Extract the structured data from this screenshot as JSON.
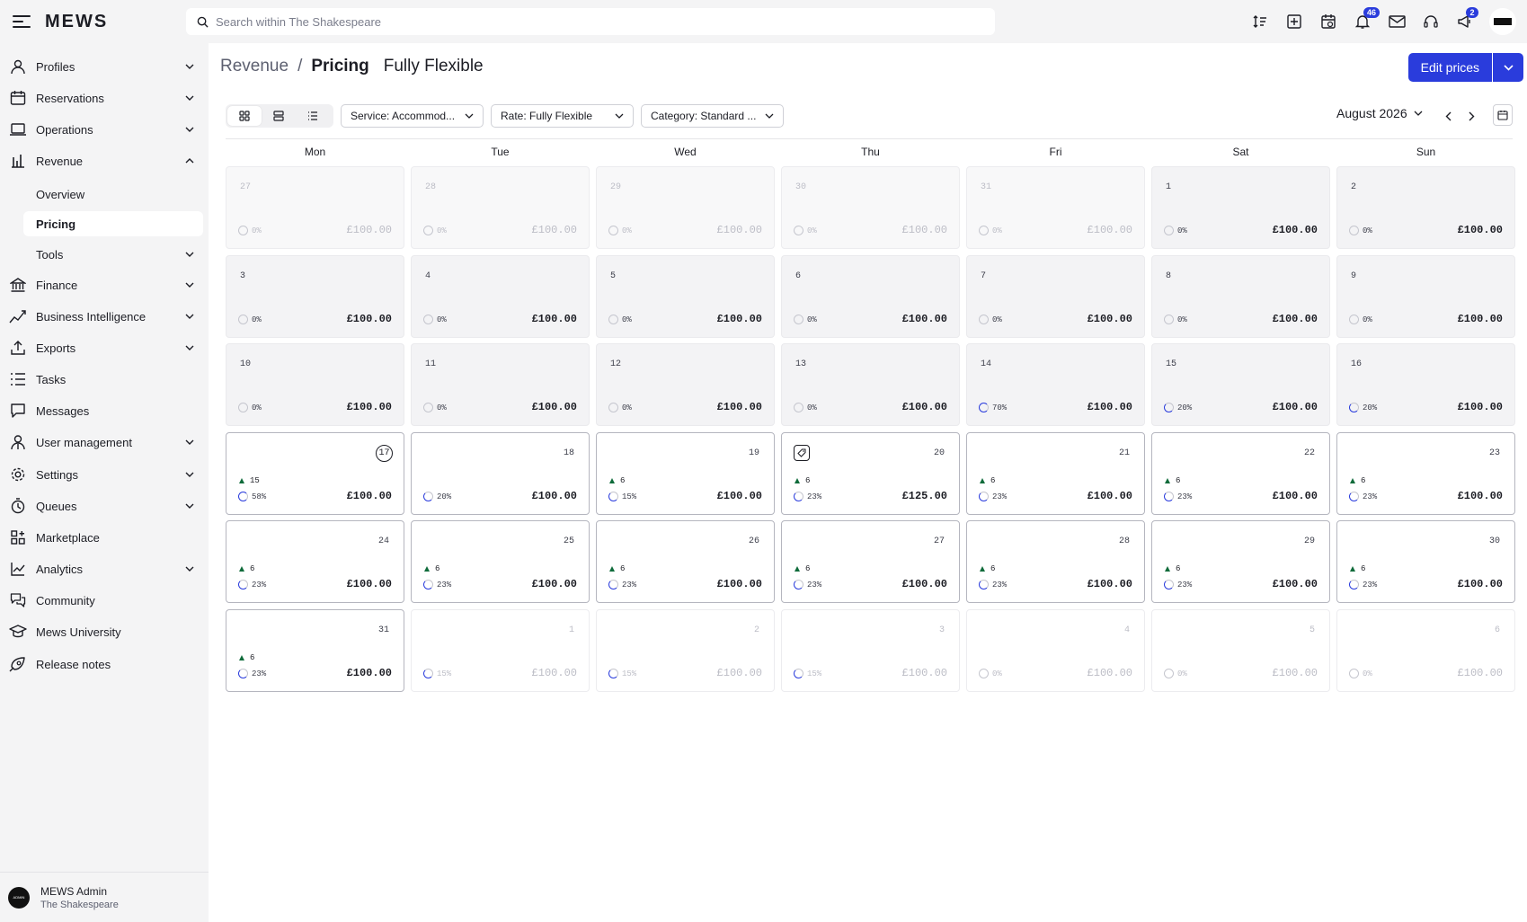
{
  "app": {
    "logo": "MEWS"
  },
  "search": {
    "placeholder": "Search within The Shakespeare"
  },
  "topbar": {
    "icons": [
      "sort-icon",
      "add-icon",
      "calendar-check-icon",
      "bell-icon",
      "mail-icon",
      "headset-icon",
      "megaphone-icon",
      "avatar"
    ],
    "notifications_badge": "46",
    "announcements_badge": "2"
  },
  "sidebar": {
    "items": [
      {
        "label": "Profiles",
        "icon": "person-icon",
        "expandable": true
      },
      {
        "label": "Reservations",
        "icon": "calendar-icon",
        "expandable": true
      },
      {
        "label": "Operations",
        "icon": "laptop-icon",
        "expandable": true
      },
      {
        "label": "Revenue",
        "icon": "bar-chart-icon",
        "expandable": true,
        "expanded": true
      },
      {
        "label": "Tools",
        "icon": "",
        "expandable": true
      },
      {
        "label": "Finance",
        "icon": "bank-icon",
        "expandable": true
      },
      {
        "label": "Business Intelligence",
        "icon": "trend-icon",
        "expandable": true
      },
      {
        "label": "Exports",
        "icon": "export-icon",
        "expandable": true
      },
      {
        "label": "Tasks",
        "icon": "tasks-icon",
        "expandable": false
      },
      {
        "label": "Messages",
        "icon": "message-icon",
        "expandable": false
      },
      {
        "label": "User management",
        "icon": "user-manage-icon",
        "expandable": true
      },
      {
        "label": "Settings",
        "icon": "gear-icon",
        "expandable": true
      },
      {
        "label": "Queues",
        "icon": "clock-icon",
        "expandable": true
      },
      {
        "label": "Marketplace",
        "icon": "apps-icon",
        "expandable": false
      },
      {
        "label": "Analytics",
        "icon": "line-chart-icon",
        "expandable": true
      },
      {
        "label": "Community",
        "icon": "community-icon",
        "expandable": false
      },
      {
        "label": "Mews University",
        "icon": "graduation-icon",
        "expandable": false
      },
      {
        "label": "Release notes",
        "icon": "rocket-icon",
        "expandable": false
      }
    ],
    "sub_items": [
      {
        "label": "Overview",
        "active": false
      },
      {
        "label": "Pricing",
        "active": true
      }
    ]
  },
  "user": {
    "name": "MEWS Admin",
    "property": "The Shakespeare",
    "avatar_text": "ADMIN"
  },
  "breadcrumb": {
    "section": "Revenue",
    "separator": "/",
    "page": "Pricing",
    "rate": "Fully Flexible"
  },
  "actions": {
    "edit_prices": "Edit prices"
  },
  "filters": {
    "service": "Service: Accommod...",
    "rate": "Rate: Fully Flexible",
    "category": "Category: Standard ..."
  },
  "calendar": {
    "month": "August 2026",
    "weekdays": [
      "Mon",
      "Tue",
      "Wed",
      "Thu",
      "Fri",
      "Sat",
      "Sun"
    ],
    "weeks": [
      [
        {
          "day": "27",
          "occ": "0%",
          "price": "£100.00",
          "state": "past",
          "outside": true
        },
        {
          "day": "28",
          "occ": "0%",
          "price": "£100.00",
          "state": "past",
          "outside": true
        },
        {
          "day": "29",
          "occ": "0%",
          "price": "£100.00",
          "state": "past",
          "outside": true
        },
        {
          "day": "30",
          "occ": "0%",
          "price": "£100.00",
          "state": "past",
          "outside": true
        },
        {
          "day": "31",
          "occ": "0%",
          "price": "£100.00",
          "state": "past",
          "outside": true
        },
        {
          "day": "1",
          "occ": "0%",
          "price": "£100.00",
          "state": "past"
        },
        {
          "day": "2",
          "occ": "0%",
          "price": "£100.00",
          "state": "past"
        }
      ],
      [
        {
          "day": "3",
          "occ": "0%",
          "price": "£100.00",
          "state": "past"
        },
        {
          "day": "4",
          "occ": "0%",
          "price": "£100.00",
          "state": "past"
        },
        {
          "day": "5",
          "occ": "0%",
          "price": "£100.00",
          "state": "past"
        },
        {
          "day": "6",
          "occ": "0%",
          "price": "£100.00",
          "state": "past"
        },
        {
          "day": "7",
          "occ": "0%",
          "price": "£100.00",
          "state": "past"
        },
        {
          "day": "8",
          "occ": "0%",
          "price": "£100.00",
          "state": "past"
        },
        {
          "day": "9",
          "occ": "0%",
          "price": "£100.00",
          "state": "past"
        }
      ],
      [
        {
          "day": "10",
          "occ": "0%",
          "price": "£100.00",
          "state": "past"
        },
        {
          "day": "11",
          "occ": "0%",
          "price": "£100.00",
          "state": "past"
        },
        {
          "day": "12",
          "occ": "0%",
          "price": "£100.00",
          "state": "past"
        },
        {
          "day": "13",
          "occ": "0%",
          "price": "£100.00",
          "state": "past"
        },
        {
          "day": "14",
          "occ": "70%",
          "price": "£100.00",
          "state": "past"
        },
        {
          "day": "15",
          "occ": "20%",
          "price": "£100.00",
          "state": "past"
        },
        {
          "day": "16",
          "occ": "20%",
          "price": "£100.00",
          "state": "past"
        }
      ],
      [
        {
          "day": "17",
          "avail": "15",
          "occ": "58%",
          "price": "£100.00",
          "state": "future",
          "today": true
        },
        {
          "day": "18",
          "occ": "20%",
          "price": "£100.00",
          "state": "future"
        },
        {
          "day": "19",
          "avail": "6",
          "occ": "15%",
          "price": "£100.00",
          "state": "future"
        },
        {
          "day": "20",
          "avail": "6",
          "occ": "23%",
          "price": "£125.00",
          "state": "future",
          "tag": true
        },
        {
          "day": "21",
          "avail": "6",
          "occ": "23%",
          "price": "£100.00",
          "state": "future"
        },
        {
          "day": "22",
          "avail": "6",
          "occ": "23%",
          "price": "£100.00",
          "state": "future"
        },
        {
          "day": "23",
          "avail": "6",
          "occ": "23%",
          "price": "£100.00",
          "state": "future"
        }
      ],
      [
        {
          "day": "24",
          "avail": "6",
          "occ": "23%",
          "price": "£100.00",
          "state": "future"
        },
        {
          "day": "25",
          "avail": "6",
          "occ": "23%",
          "price": "£100.00",
          "state": "future"
        },
        {
          "day": "26",
          "avail": "6",
          "occ": "23%",
          "price": "£100.00",
          "state": "future"
        },
        {
          "day": "27",
          "avail": "6",
          "occ": "23%",
          "price": "£100.00",
          "state": "future"
        },
        {
          "day": "28",
          "avail": "6",
          "occ": "23%",
          "price": "£100.00",
          "state": "future"
        },
        {
          "day": "29",
          "avail": "6",
          "occ": "23%",
          "price": "£100.00",
          "state": "future"
        },
        {
          "day": "30",
          "avail": "6",
          "occ": "23%",
          "price": "£100.00",
          "state": "future"
        }
      ],
      [
        {
          "day": "31",
          "avail": "6",
          "occ": "23%",
          "price": "£100.00",
          "state": "future"
        },
        {
          "day": "1",
          "occ": "15%",
          "price": "£100.00",
          "state": "future",
          "outside": true
        },
        {
          "day": "2",
          "occ": "15%",
          "price": "£100.00",
          "state": "future",
          "outside": true
        },
        {
          "day": "3",
          "occ": "15%",
          "price": "£100.00",
          "state": "future",
          "outside": true
        },
        {
          "day": "4",
          "occ": "0%",
          "price": "£100.00",
          "state": "future",
          "outside": true
        },
        {
          "day": "5",
          "occ": "0%",
          "price": "£100.00",
          "state": "future",
          "outside": true
        },
        {
          "day": "6",
          "occ": "0%",
          "price": "£100.00",
          "state": "future",
          "outside": true
        }
      ]
    ]
  },
  "colors": {
    "accent": "#2a3cdc",
    "availability_up": "#0e6b3a",
    "sidebar_bg": "#f4f4f5"
  }
}
